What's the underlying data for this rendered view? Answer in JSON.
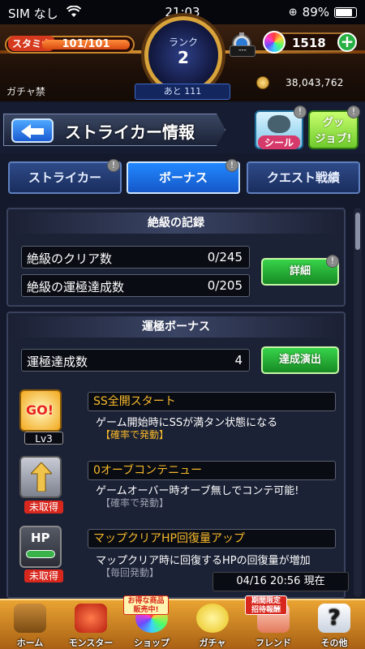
{
  "statusbar": {
    "carrier": "SIM なし",
    "time": "21:03",
    "battery": "89%"
  },
  "header": {
    "stamina_label": "スタミナ",
    "stamina_value": "101/101",
    "rank_label": "ランク",
    "rank_value": "2",
    "rank_next": "あと 111",
    "timer_value": "---",
    "orb_count": "1518",
    "gacha_status": "ガチャ禁",
    "coins": "38,043,762"
  },
  "title_bar": {
    "title": "ストライカー情報",
    "seal_label": "シール",
    "goods_label_1": "グッ",
    "goods_label_2": "ジョブ!"
  },
  "tabs": [
    {
      "label": "ストライカー"
    },
    {
      "label": "ボーナス"
    },
    {
      "label": "クエスト戦績"
    }
  ],
  "zekkyu": {
    "header": "絶級の記録",
    "clear_label": "絶級のクリア数",
    "clear_value": "0/245",
    "unkyoku_label": "絶級の運極達成数",
    "unkyoku_value": "0/205",
    "detail_button": "詳細"
  },
  "bonus": {
    "header": "運極ボーナス",
    "count_label": "運極達成数",
    "count_value": "4",
    "effect_button": "達成演出",
    "items": [
      {
        "icon_text": "GO!",
        "level": "Lv3",
        "title": "SS全開スタート",
        "desc": "ゲーム開始時にSSが満タン状態になる",
        "note": "【確率で発動】"
      },
      {
        "icon_text": "",
        "level": "未取得",
        "title": "0オーブコンテニュー",
        "desc": "ゲームオーバー時オーブ無しでコンテ可能!",
        "note": "【確率で発動】"
      },
      {
        "icon_text": "HP",
        "level": "未取得",
        "title": "マップクリアHP回復量アップ",
        "desc": "マップクリア時に回復するHPの回復量が増加",
        "note": "【毎回発動】"
      }
    ]
  },
  "timestamp": "04/16 20:56 現在",
  "bottom_nav": [
    {
      "label": "ホーム",
      "icon": "home-icon"
    },
    {
      "label": "モンスター",
      "icon": "monster-icon"
    },
    {
      "label": "ショップ",
      "icon": "shop-icon"
    },
    {
      "label": "ガチャ",
      "icon": "gacha-icon"
    },
    {
      "label": "フレンド",
      "icon": "friend-icon"
    },
    {
      "label": "その他",
      "icon": "other-icon"
    }
  ],
  "badges": {
    "shop_1": "お得な商品",
    "shop_2": "販売中!",
    "friend_1": "期間限定",
    "friend_2": "招待報酬"
  },
  "alert_mark": "!",
  "colors": {
    "accent_blue": "#1e6fe0",
    "accent_green": "#2fb63a",
    "gold": "#d8a33b",
    "highlight_text": "#f5b82a",
    "gray_text": "#9aa0ad"
  }
}
